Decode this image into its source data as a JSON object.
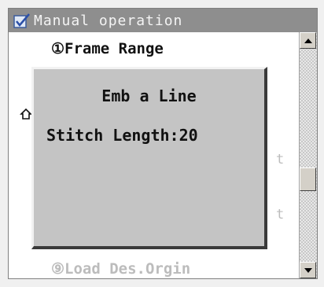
{
  "window": {
    "title": "Manual operation",
    "title_icon": "checkbox-icon"
  },
  "menu": {
    "items": [
      {
        "label": "①Frame Range"
      },
      {
        "label": "⑨Load Des.Orgin"
      }
    ],
    "partial_icon": "home-icon",
    "partial_suffix_1": "t",
    "partial_suffix_2": "t"
  },
  "dialog": {
    "title": "Emb a Line",
    "field_label": "Stitch Length:",
    "field_value": "20"
  },
  "colors": {
    "titlebar_bg": "#8e8e8e",
    "dialog_bg": "#c4c4c4",
    "disabled_text": "#bcbcbc"
  }
}
